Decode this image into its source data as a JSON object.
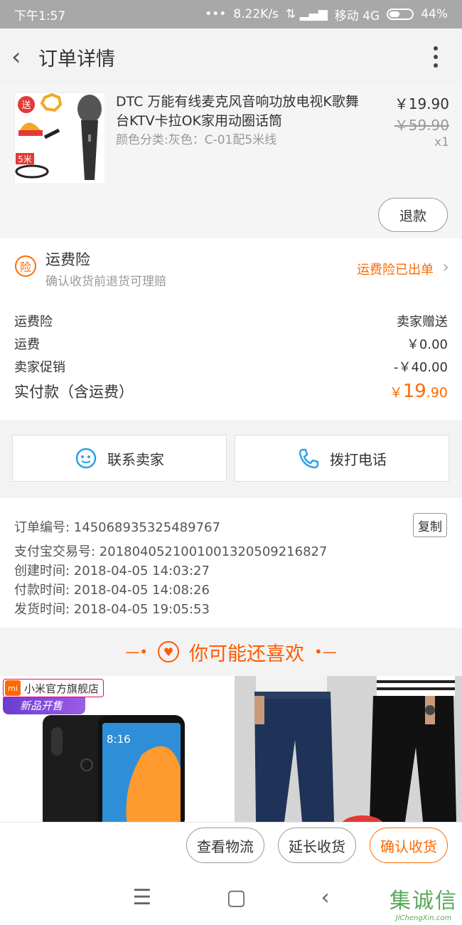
{
  "status_bar": {
    "time": "下午1:57",
    "network_speed": "8.22K/s",
    "carrier": "移动 4G",
    "battery": "44%"
  },
  "header": {
    "title": "订单详情"
  },
  "product": {
    "name": "DTC 万能有线麦克风音响功放电视K歌舞台KTV卡拉OK家用动圈话筒",
    "sku": "颜色分类:灰色：C-01配5米线",
    "price": "￥19.90",
    "original_price": "￥59.90",
    "quantity": "x1",
    "refund_label": "退款",
    "thumb_labels": {
      "gift": "送",
      "length": "5米"
    }
  },
  "insurance": {
    "icon_char": "险",
    "title": "运费险",
    "subtitle": "确认收货前退货可理赔",
    "status": "运费险已出单"
  },
  "summary": [
    {
      "label": "运费险",
      "value": "卖家赠送"
    },
    {
      "label": "运费",
      "value": "￥0.00"
    },
    {
      "label": "卖家促销",
      "value": "-￥40.00"
    }
  ],
  "total": {
    "label": "实付款（含运费）",
    "symbol": "￥",
    "integer": "19",
    "decimal": ".90"
  },
  "contact": {
    "seller": "联系卖家",
    "call": "拨打电话"
  },
  "order_info": {
    "order_no": "订单编号: 145068935325489767",
    "copy_label": "复制",
    "alipay_no": "支付宝交易号: 2018040521001001320509216827",
    "created": "创建时间: 2018-04-05 14:03:27",
    "paid": "付款时间: 2018-04-05 14:08:26",
    "shipped": "发货时间: 2018-04-05 19:05:53"
  },
  "recommend": {
    "title": "你可能还喜欢",
    "store_name": "小米官方旗舰店",
    "store_logo": "mi",
    "promo_tag": "新品开售",
    "phone_time": "8:16"
  },
  "actions": {
    "logistics": "查看物流",
    "extend": "延长收货",
    "confirm": "确认收货"
  },
  "watermark": {
    "text": "集诚信",
    "url": "JiChengXin.com"
  },
  "colors": {
    "accent": "#ff6a00",
    "contact_icon": "#2aa3e8"
  }
}
